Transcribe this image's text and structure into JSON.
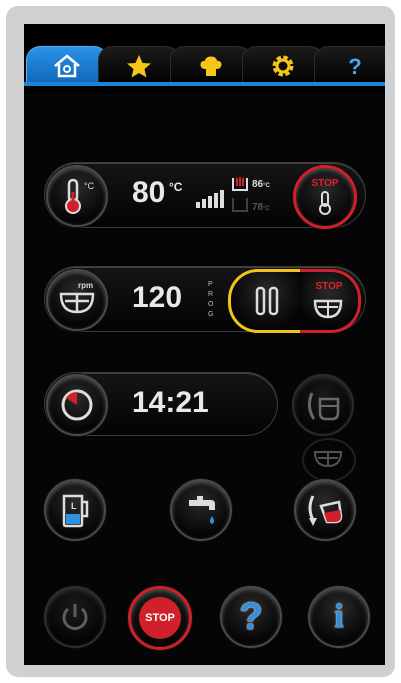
{
  "tabs": [
    {
      "name": "home",
      "icon": "home-icon",
      "active": true
    },
    {
      "name": "favorites",
      "icon": "star-icon",
      "active": false
    },
    {
      "name": "chef",
      "icon": "chef-hat-icon",
      "active": false
    },
    {
      "name": "settings",
      "icon": "gear-icon",
      "active": false
    },
    {
      "name": "help",
      "icon": "question-icon",
      "active": false
    }
  ],
  "temperature": {
    "value": "80",
    "unit": "°C",
    "icon_unit": "°C",
    "bowl_temp": "86",
    "bowl_unit": "°C",
    "second_temp": "78",
    "second_unit": "°C",
    "stop_label": "STOP"
  },
  "speed": {
    "value": "120",
    "rpm_label": "rpm",
    "prog_label": "PROG",
    "stop_label": "STOP"
  },
  "timer": {
    "value": "14:21"
  },
  "bottom": {
    "stop_label": "STOP",
    "help_label": "?",
    "info_label": "i"
  },
  "colors": {
    "accent_blue": "#1a84d8",
    "stop_red": "#d0212a",
    "pause_yellow": "#f0c419",
    "water_blue": "#2f8fe0"
  }
}
